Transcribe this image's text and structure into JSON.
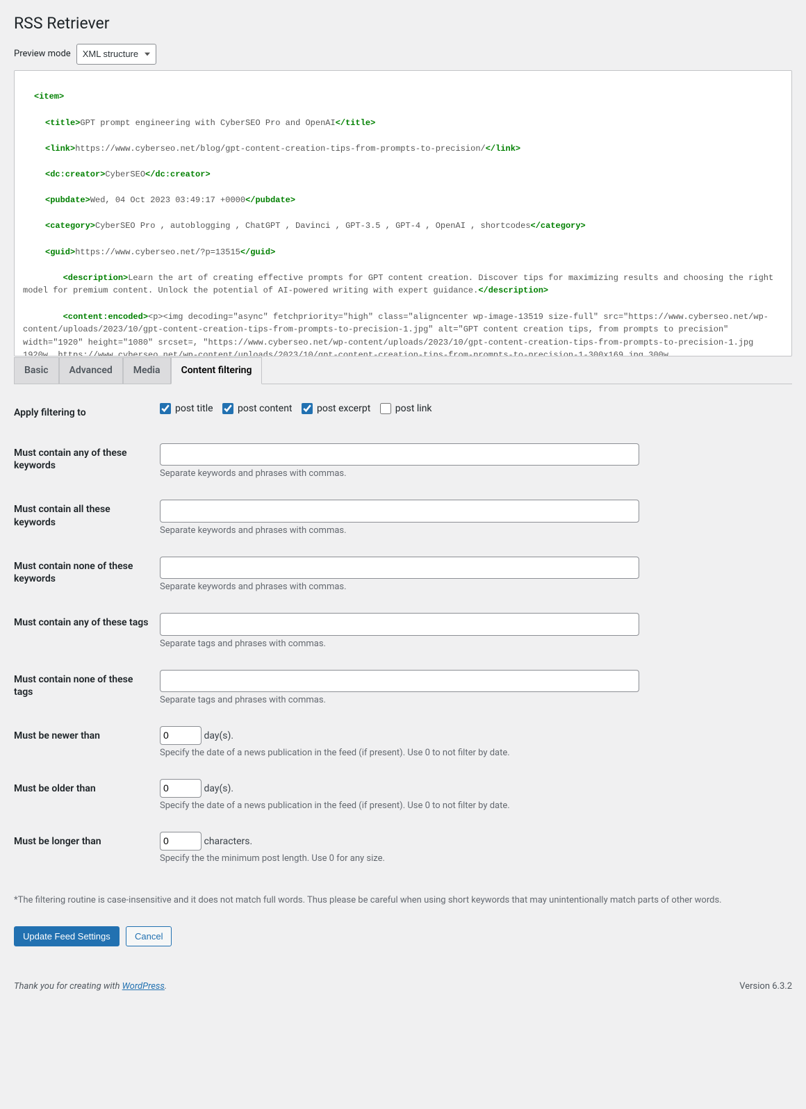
{
  "page_title": "RSS Retriever",
  "preview": {
    "label": "Preview mode",
    "selected": "XML structure"
  },
  "xml": {
    "item_open": "<item>",
    "title_open": "<title>",
    "title_text": "GPT prompt engineering with CyberSEO Pro and OpenAI",
    "title_close": "</title>",
    "link_open": "<link>",
    "link_text": "https://www.cyberseo.net/blog/gpt-content-creation-tips-from-prompts-to-precision/",
    "link_close": "</link>",
    "creator_open": "<dc:creator>",
    "creator_text": "CyberSEO",
    "creator_close": "</dc:creator>",
    "pubdate_open": "<pubdate>",
    "pubdate_text": "Wed, 04 Oct 2023 03:49:17 +0000",
    "pubdate_close": "</pubdate>",
    "category_open": "<category>",
    "category_text": "CyberSEO Pro , autoblogging , ChatGPT , Davinci , GPT-3.5 , GPT-4 , OpenAI , shortcodes",
    "category_close": "</category>",
    "guid_open": "<guid>",
    "guid_text": "https://www.cyberseo.net/?p=13515",
    "guid_close": "</guid>",
    "desc_open": "<description>",
    "desc_text": "Learn the art of creating effective prompts for GPT content creation. Discover tips for maximizing results and choosing the right model for premium content. Unlock the potential of AI-powered writing with expert guidance.",
    "desc_close": "</description>",
    "content_open": "<content:encoded>",
    "content_text": "<p><img decoding=\"async\" fetchpriority=\"high\" class=\"aligncenter wp-image-13519 size-full\" src=\"https://www.cyberseo.net/wp-content/uploads/2023/10/gpt-content-creation-tips-from-prompts-to-precision-1.jpg\" alt=\"GPT content creation tips, from prompts to precision\" width=\"1920\" height=\"1080\" srcset=, \"https://www.cyberseo.net/wp-content/uploads/2023/10/gpt-content-creation-tips-from-prompts-to-precision-1.jpg 1920w, https://www.cyberseo.net/wp-content/uploads/2023/10/gpt-content-creation-tips-from-prompts-to-precision-1-300x169.jpg 300w, https://www.cyberseo.net/wp-content/uploads/2023/10/gpt-content-creation-tips-from-prompts-to-precision-1-1024x576.jpg 1024w, https://www.cyberseo.net/wp-content/uploads/2023/10/gpt-content-creation-tips-from-prompts-to-precision-1-150x84.jpg 150w, https://www.cyberseo.net/wp-content/uploads/2023/10/gpt-content-creation-tips-from-prompts-to-precision-1-768x432.jpg 768w, https://www.cyberseo.net/wp-content/uploads/2023/10/gpt-content-creation-tips-from-prompts-to-precision-1-1536x864.jpg 1536w\" sizes=\"(max-width: 1920px) 100vw, 1920px\" /></p> <p>When working with GPT, the key to getting accurate results lies in the correct creation of your prompts (the very prompts you use in the <a href=\"https://www.cyberseo.net/\"><strong>CyberSEO Pro</strong></a> plugin or <strong><a href=\"https://www.cyberseo.net/rssretriever/\">RSS Retriever</a></strong> post title and post content assignments). It often seems that the plugin doesn&#8217;t work as expected – it doesn&#8217;t fetch the full article, loses the original formatting or simply generates incorrect or empty output. The problem is not with the plugin, it&#8217;s with your prompt.</p> <p>Since access to OpenAI&#8217;s GPT-4 model is still not available to everyone, and the API for this model is quite expensive to use, you&#8217;ll probably have to work with GPT-3.5 models most of the time. While these models may lag behind GPT-4 in terms of intelligence, they are still capable of producing high-quality content that rivals the results of GPT-4. The main difference is not in results, but in prompt engineering, which we&#8217;ll explore in this article.</p> <p>Let&#8217;s start by exploring a couple of critical nuances that will directly affect the content generated by the plugin in automatic mode. These nuances will make a dramatic difference.</p> <h2>HTML markup</h2> <p>If you plan"
  },
  "tabs": [
    "Basic",
    "Advanced",
    "Media",
    "Content filtering"
  ],
  "active_tab": "Content filtering",
  "filter_apply": {
    "label": "Apply filtering to",
    "options": {
      "post_title": {
        "label": "post title",
        "checked": true
      },
      "post_content": {
        "label": "post content",
        "checked": true
      },
      "post_excerpt": {
        "label": "post excerpt",
        "checked": true
      },
      "post_link": {
        "label": "post link",
        "checked": false
      }
    }
  },
  "fields": {
    "any_keywords": {
      "label": "Must contain any of these keywords",
      "value": "",
      "hint": "Separate keywords and phrases with commas."
    },
    "all_keywords": {
      "label": "Must contain all these keywords",
      "value": "",
      "hint": "Separate keywords and phrases with commas."
    },
    "none_keywords": {
      "label": "Must contain none of these keywords",
      "value": "",
      "hint": "Separate keywords and phrases with commas."
    },
    "any_tags": {
      "label": "Must contain any of these tags",
      "value": "",
      "hint": "Separate tags and phrases with commas."
    },
    "none_tags": {
      "label": "Must contain none of these tags",
      "value": "",
      "hint": "Separate tags and phrases with commas."
    },
    "newer_than": {
      "label": "Must be newer than",
      "value": 0,
      "unit": "day(s).",
      "hint": "Specify the date of a news publication in the feed (if present). Use 0 to not filter by date."
    },
    "older_than": {
      "label": "Must be older than",
      "value": 0,
      "unit": "day(s).",
      "hint": "Specify the date of a news publication in the feed (if present). Use 0 to not filter by date."
    },
    "longer_than": {
      "label": "Must be longer than",
      "value": 0,
      "unit": "characters.",
      "hint": "Specify the the minimum post length. Use 0 for any size."
    }
  },
  "note": "*The filtering routine is case-insensitive and it does not match full words. Thus please be careful when using short keywords that may unintentionally match parts of other words.",
  "buttons": {
    "save": "Update Feed Settings",
    "cancel": "Cancel"
  },
  "footer": {
    "thanks_prefix": "Thank you for creating with ",
    "thanks_link": "WordPress",
    "thanks_suffix": ".",
    "version": "Version 6.3.2"
  }
}
